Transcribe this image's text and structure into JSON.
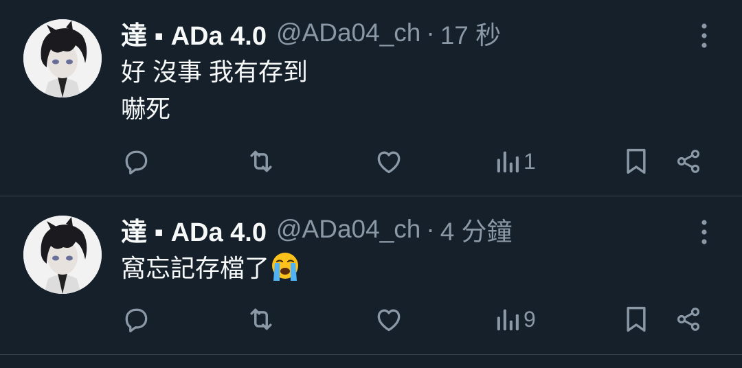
{
  "tweets": [
    {
      "display_name": "達 ▪ ADa 4.0",
      "handle": "@ADa04_ch",
      "separator": "·",
      "time": "17 秒",
      "lines": [
        "好 沒事 我有存到",
        "嚇死"
      ],
      "views": "1",
      "avatar": "anime-boy-avatar"
    },
    {
      "display_name": "達 ▪ ADa 4.0",
      "handle": "@ADa04_ch",
      "separator": "·",
      "time": "4 分鐘",
      "lines": [
        "窩忘記存檔了"
      ],
      "emoji": "loudly-crying-face",
      "views": "9",
      "avatar": "anime-boy-avatar"
    }
  ],
  "colors": {
    "background": "#15202b",
    "divider": "#38444d",
    "text_primary": "#f7f9f9",
    "text_secondary": "#8b98a5"
  },
  "icons": {
    "reply": "reply-icon",
    "retweet": "retweet-icon",
    "like": "heart-icon",
    "views": "views-icon",
    "bookmark": "bookmark-icon",
    "share": "share-icon",
    "more": "more-vertical-icon"
  }
}
